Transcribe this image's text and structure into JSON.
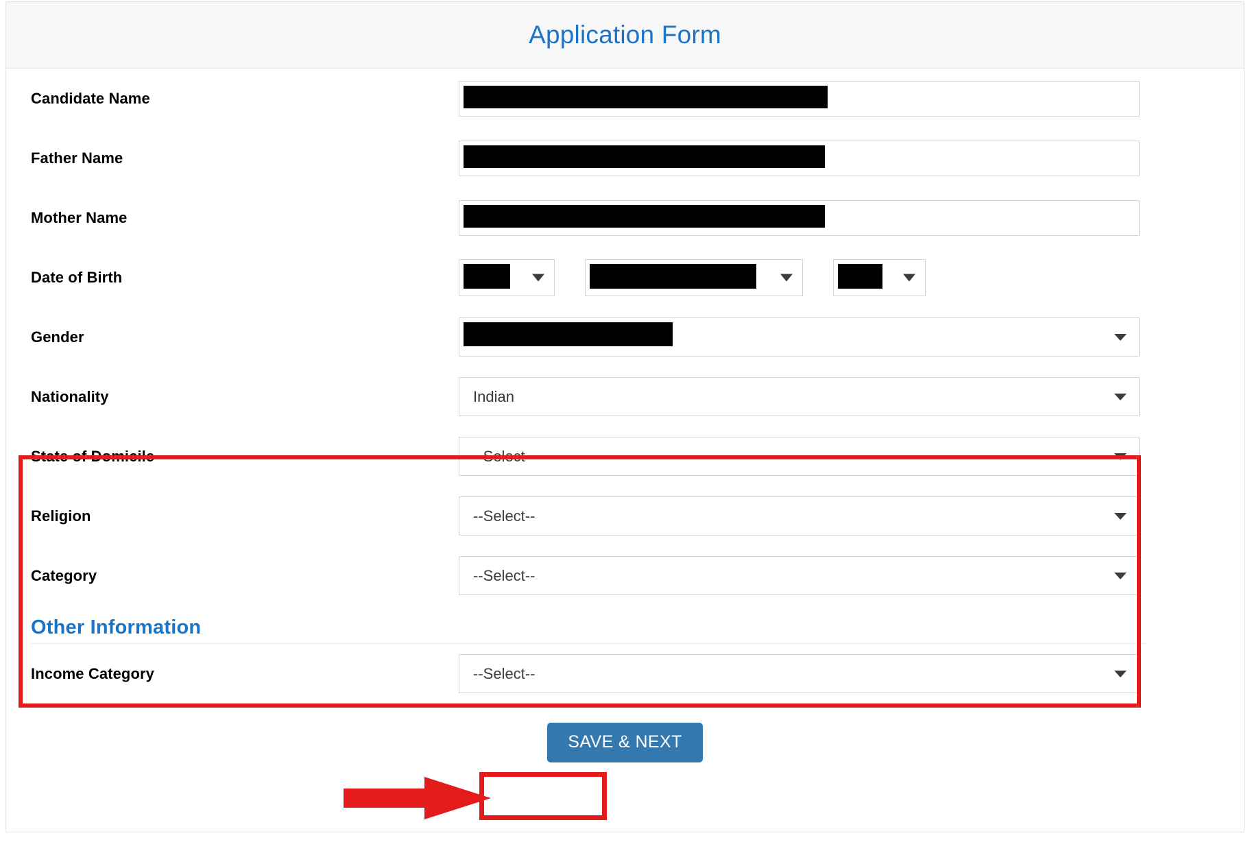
{
  "header": {
    "title": "Application Form",
    "title_color": "#1b74c8"
  },
  "fields": [
    {
      "label": "Candidate Name",
      "type": "text",
      "value": "",
      "redacted": true,
      "redact_width": 531
    },
    {
      "label": "Father Name",
      "type": "text",
      "value": "",
      "redacted": true,
      "redact_width": 527
    },
    {
      "label": "Mother Name",
      "type": "text",
      "value": "",
      "redacted": true,
      "redact_width": 527
    },
    {
      "label": "Date of Birth",
      "type": "date-group"
    },
    {
      "label": "Gender",
      "type": "select",
      "value": "",
      "redacted": true,
      "redact_width": 305
    },
    {
      "label": "Nationality",
      "type": "select",
      "value": "Indian",
      "redacted": false
    },
    {
      "label": "State of Domicile",
      "type": "select",
      "value": "--Select--",
      "redacted": false
    },
    {
      "label": "Religion",
      "type": "select",
      "value": "--Select--",
      "redacted": false
    },
    {
      "label": "Category",
      "type": "select",
      "value": "--Select--",
      "redacted": false
    }
  ],
  "dob": {
    "day": {
      "value": "",
      "redacted": true,
      "redact_width": 68
    },
    "month": {
      "value": "",
      "redacted": true,
      "redact_width": 243
    },
    "year": {
      "value": "",
      "redacted": true,
      "redact_width": 65
    }
  },
  "other_information": {
    "heading": "Other Information",
    "income_category": {
      "label": "Income Category",
      "value": "--Select--"
    }
  },
  "footer": {
    "save_label": "SAVE & NEXT",
    "save_bg": "#3478b0",
    "save_text_color": "#ffffff"
  },
  "annotations": {
    "highlight_color": "#e31b1b",
    "arrow_color": "#e31b1b"
  }
}
